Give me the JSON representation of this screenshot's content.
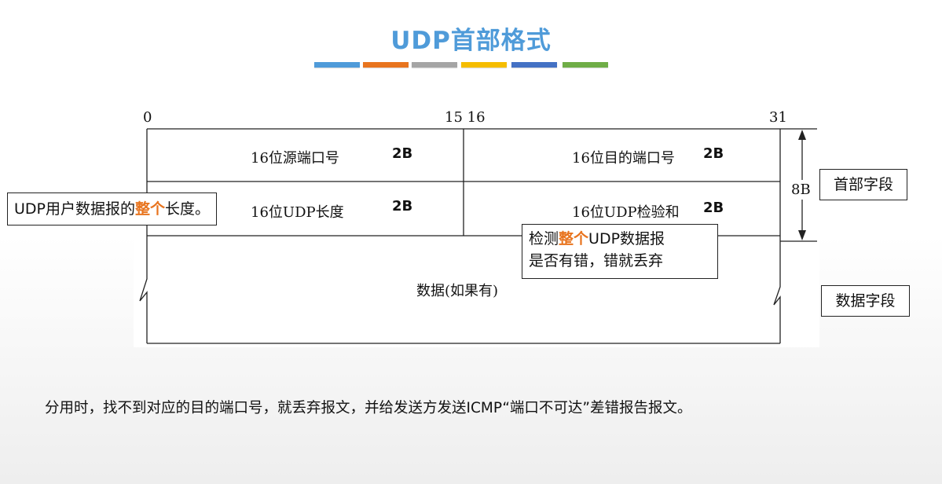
{
  "title": "UDP首部格式",
  "accent_colors": [
    "#4f9bd9",
    "#e8741e",
    "#a5a5a5",
    "#f5bd00",
    "#4471c4",
    "#6fad47"
  ],
  "bits": {
    "b0": "0",
    "b15_16": "15 16",
    "b31": "31"
  },
  "header_rows": [
    {
      "left": "16位源端口号",
      "left_size": "2B",
      "right": "16位目的端口号",
      "right_size": "2B"
    },
    {
      "left": "16位UDP长度",
      "left_size": "2B",
      "right": "16位UDP检验和",
      "right_size": "2B"
    }
  ],
  "data_label": "数据(如果有)",
  "header_size": "8B",
  "header_field_label": "首部字段",
  "data_field_label": "数据字段",
  "length_callout": {
    "pre": "UDP用户数据报的",
    "emph": "整个",
    "post": "长度。"
  },
  "checksum_callout": {
    "pre": "检测",
    "emph": "整个",
    "post": "UDP数据报",
    "line2": "是否有错，错就丢弃"
  },
  "note": "分用时，找不到对应的目的端口号，就丢弃报文，并给发送方发送ICMP“端口不可达”差错报告报文。"
}
